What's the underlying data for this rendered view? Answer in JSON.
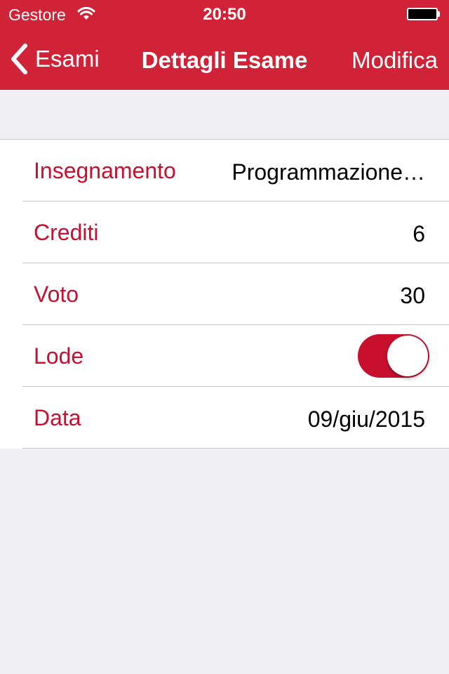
{
  "status_bar": {
    "carrier": "Gestore",
    "time": "20:50",
    "wifi_icon": "wifi-icon",
    "battery_icon": "battery-icon"
  },
  "nav": {
    "back_label": "Esami",
    "title": "Dettagli Esame",
    "edit_label": "Modifica"
  },
  "rows": [
    {
      "label": "Insegnamento",
      "value": "Programmazione…"
    },
    {
      "label": "Crediti",
      "value": "6"
    },
    {
      "label": "Voto",
      "value": "30"
    },
    {
      "label": "Lode",
      "toggle_on": true
    },
    {
      "label": "Data",
      "value": "09/giu/2015"
    }
  ],
  "colors": {
    "accent": "#d02337",
    "label": "#c8102e",
    "background": "#efeff4"
  }
}
